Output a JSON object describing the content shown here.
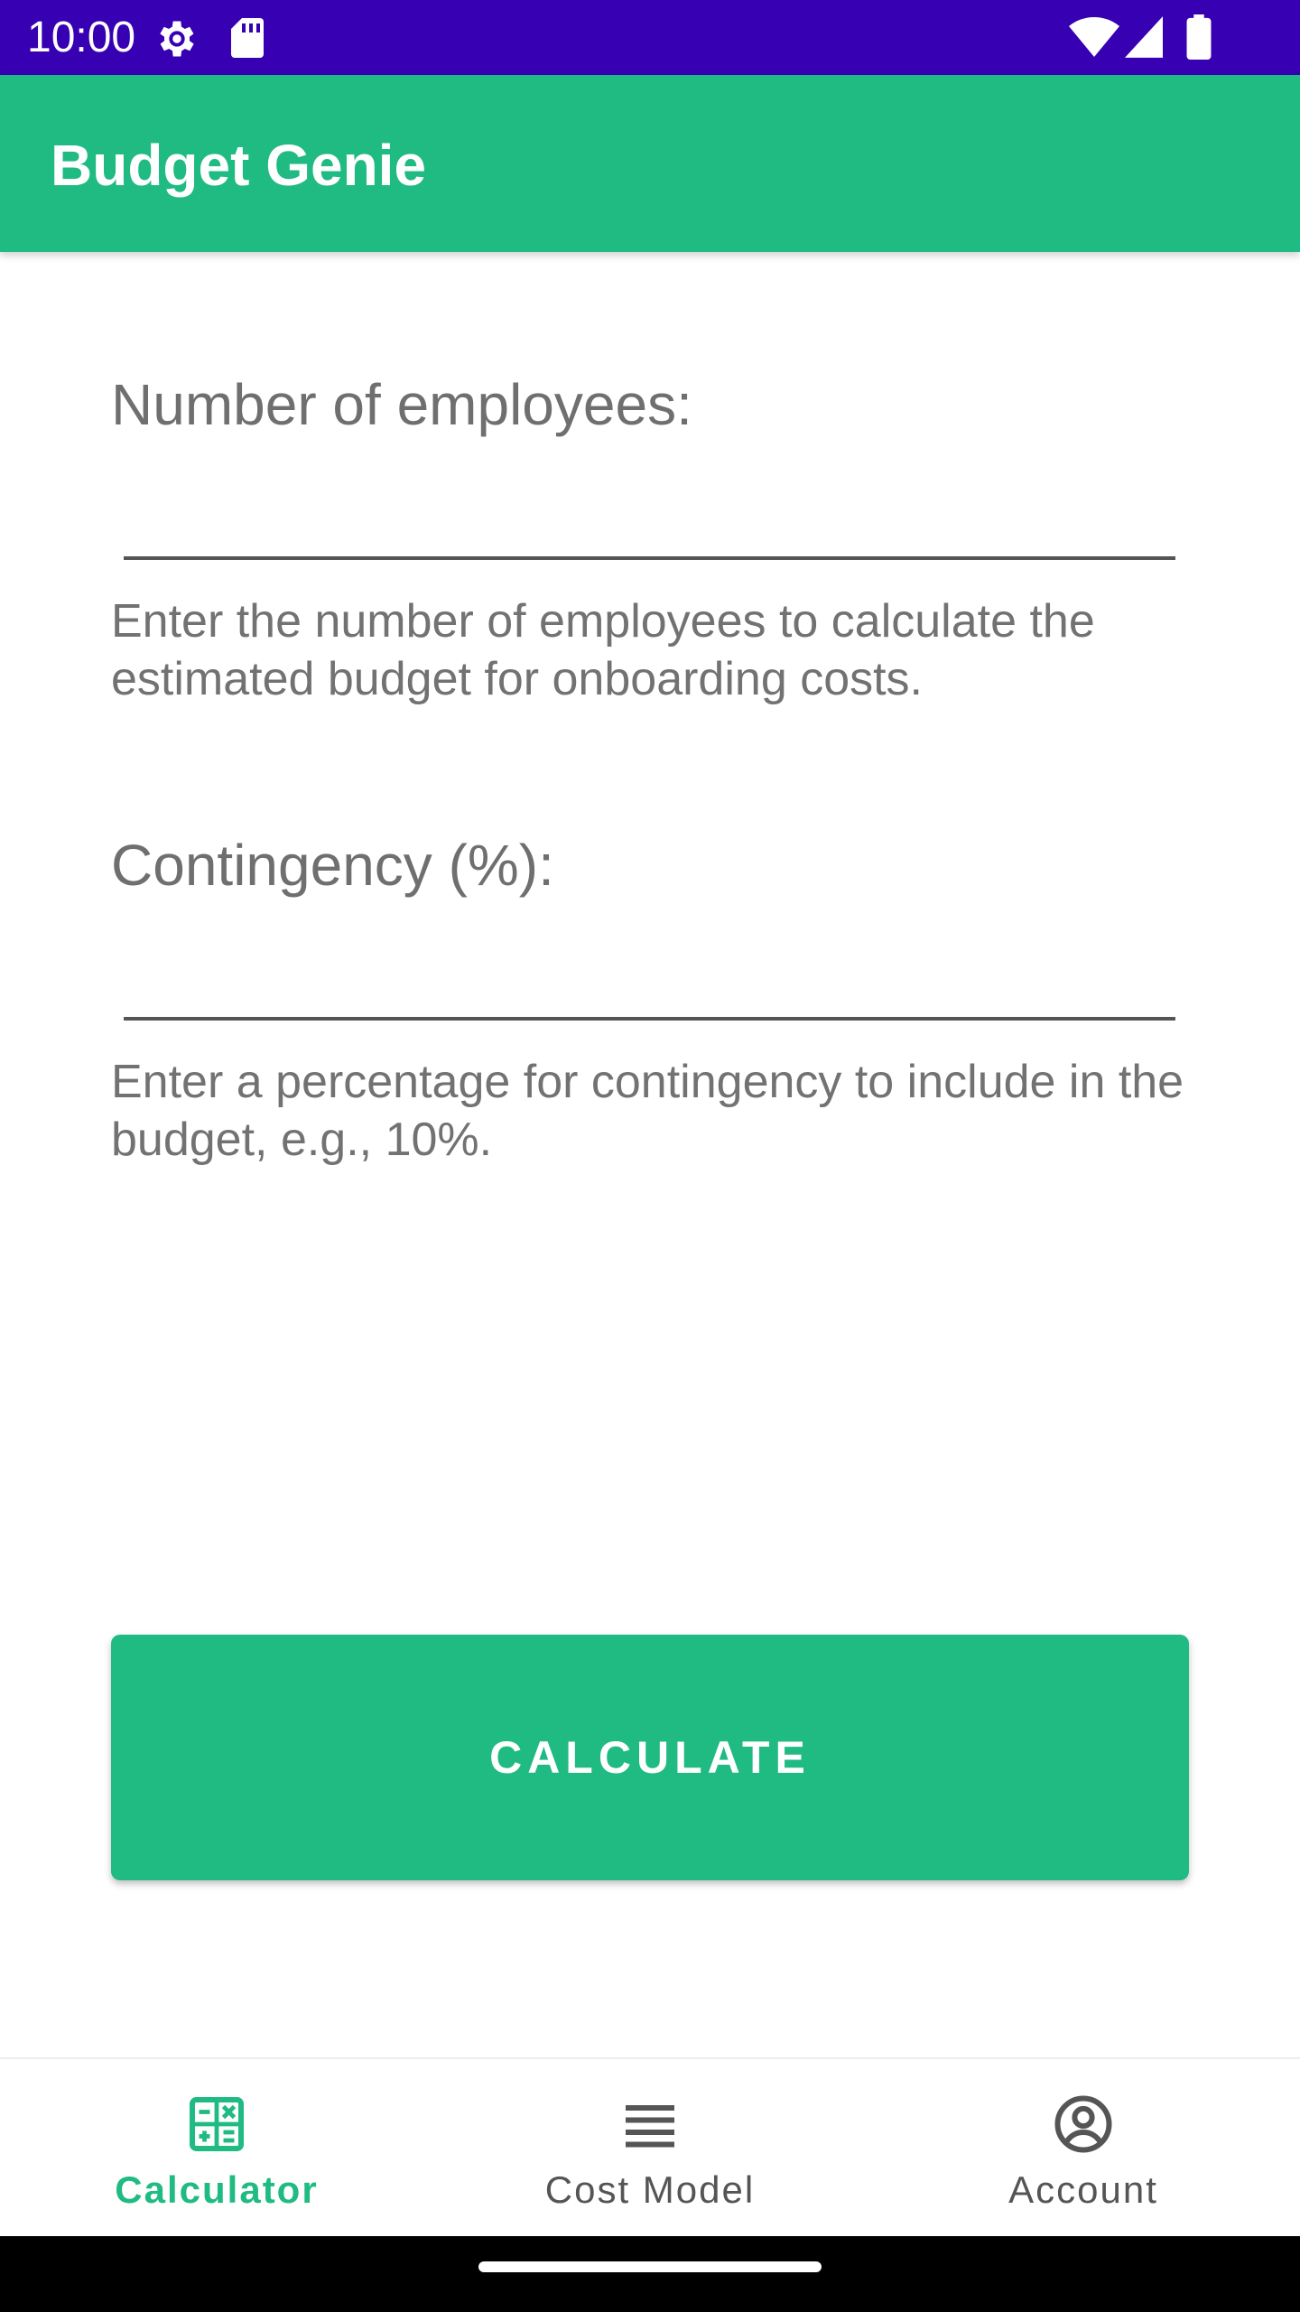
{
  "status_bar": {
    "time": "10:00",
    "icons": [
      "gear-icon",
      "sd-card-icon",
      "wifi-icon",
      "signal-icon",
      "battery-icon"
    ],
    "background": "#3700B3"
  },
  "app_bar": {
    "title": "Budget Genie",
    "background": "#20BB83"
  },
  "form": {
    "employees": {
      "label": "Number of employees:",
      "value": "",
      "placeholder": "",
      "helper": "Enter the number of employees to calculate the estimated budget for onboarding costs."
    },
    "contingency": {
      "label": "Contingency (%):",
      "value": "",
      "placeholder": "",
      "helper": "Enter a percentage for contingency to include in the budget, e.g., 10%."
    }
  },
  "actions": {
    "calculate_label": "CALCULATE"
  },
  "bottom_nav": {
    "items": [
      {
        "label": "Calculator",
        "icon": "calculator-icon",
        "selected": true
      },
      {
        "label": "Cost Model",
        "icon": "list-icon",
        "selected": false
      },
      {
        "label": "Account",
        "icon": "account-circle-icon",
        "selected": false
      }
    ],
    "active_color": "#20BB83",
    "inactive_color": "#555555"
  }
}
